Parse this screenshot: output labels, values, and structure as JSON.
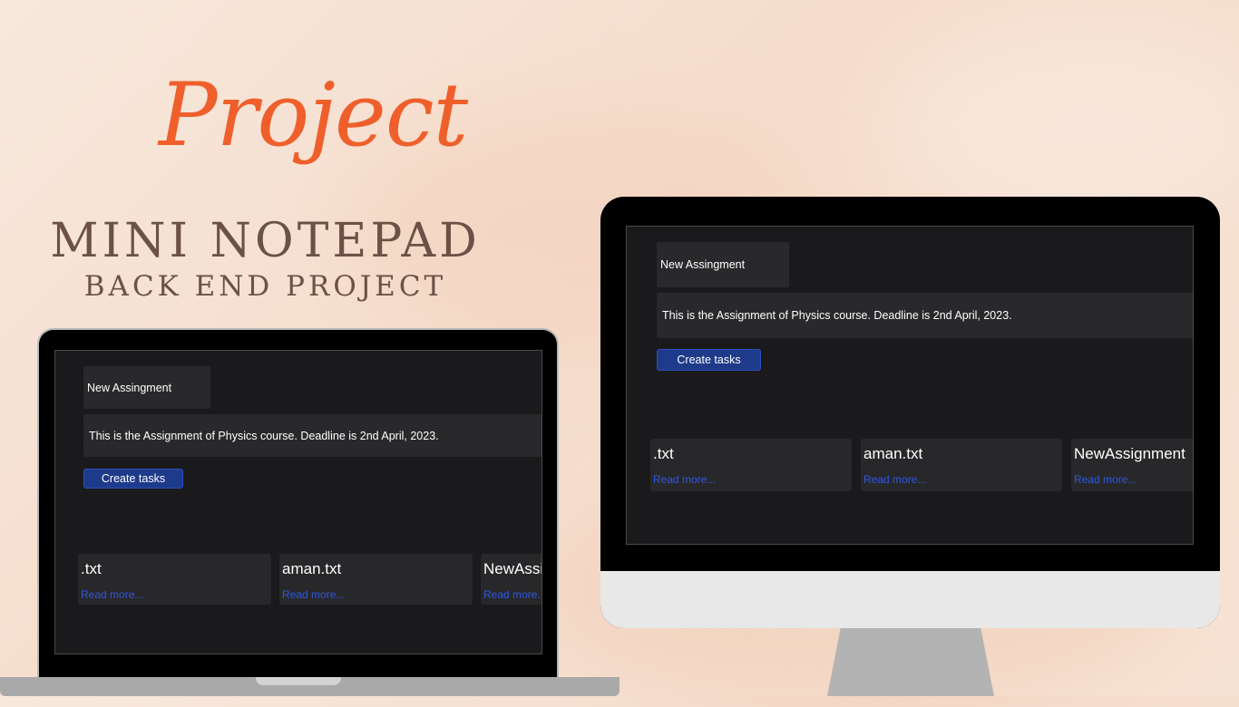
{
  "poster": {
    "script_title": "Project",
    "main_title": "MINI NOTEPAD",
    "sub_title": "BACK END PROJECT"
  },
  "app": {
    "title_value": "New Assingment",
    "description_value": "This is the Assignment of Physics course. Deadline is 2nd April, 2023.",
    "create_button": "Create tasks",
    "notes": [
      {
        "filename": ".txt",
        "link": "Read more..."
      },
      {
        "filename": "aman.txt",
        "link": "Read more..."
      },
      {
        "filename": "NewAssignment",
        "link": "Read more..."
      }
    ]
  },
  "colors": {
    "accent_orange": "#ef5f2b",
    "title_brown": "#6b5146",
    "button_blue": "#1e3a8a",
    "link_blue": "#2f57e0",
    "app_bg": "#1a1a1c"
  }
}
